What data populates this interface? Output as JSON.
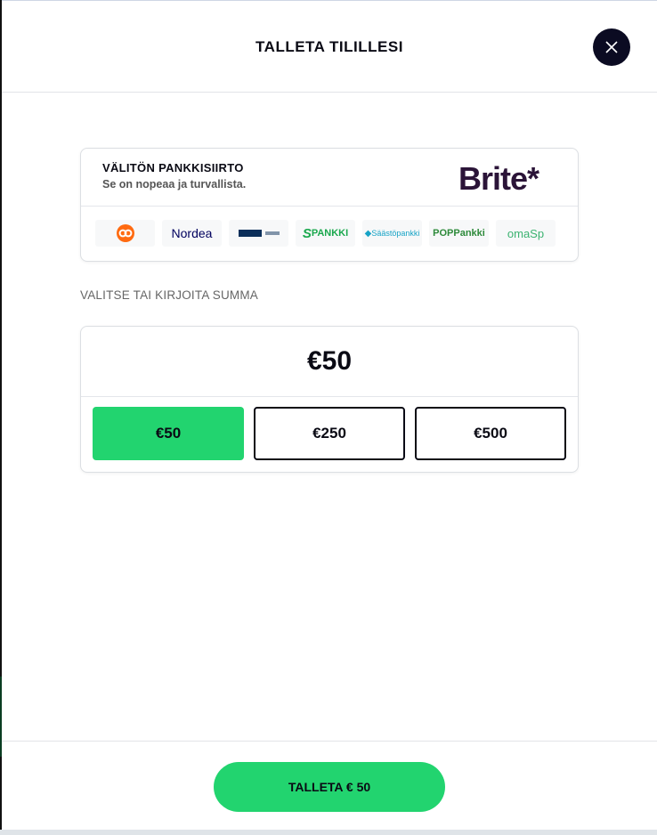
{
  "header": {
    "title": "TALLETA TILILLESI"
  },
  "bank_transfer": {
    "title": "VÄLITÖN PANKKISIIRTO",
    "subtitle": "Se on nopeaa ja turvallista.",
    "brand": "Brite*",
    "banks": [
      "Nordea",
      "PANKKI",
      "Säästöpankki",
      "POPPankki",
      "omaSp"
    ]
  },
  "amount": {
    "label": "VALITSE TAI KIRJOITA SUMMA",
    "current": "€50",
    "options": [
      "€50",
      "€250",
      "€500"
    ],
    "selected_index": 0
  },
  "footer": {
    "deposit_label": "TALLETA € 50"
  },
  "colors": {
    "accent": "#22d46f",
    "close_bg": "#0b0b22",
    "brand": "#2b1438"
  }
}
